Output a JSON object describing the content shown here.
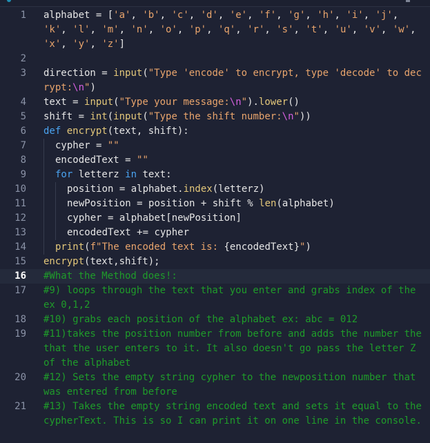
{
  "editor": {
    "language": "python",
    "current_line": 16,
    "colors": {
      "background": "#1e2233",
      "current_line_bg": "#242a3b",
      "keyword": "#4aa3f0",
      "function": "#e3c77a",
      "string": "#e8a46c",
      "escape": "#d55fde",
      "comment": "#1f9c2a",
      "line_number": "#8b93a7"
    },
    "lines": [
      {
        "n": "1",
        "tokens": [
          [
            "var",
            "alphabet "
          ],
          [
            "op",
            "= ["
          ],
          [
            "str",
            "'a'"
          ],
          [
            "op",
            ", "
          ],
          [
            "str",
            "'b'"
          ],
          [
            "op",
            ", "
          ],
          [
            "str",
            "'c'"
          ],
          [
            "op",
            ", "
          ],
          [
            "str",
            "'d'"
          ],
          [
            "op",
            ", "
          ],
          [
            "str",
            "'e'"
          ],
          [
            "op",
            ", "
          ],
          [
            "str",
            "'f'"
          ],
          [
            "op",
            ", "
          ],
          [
            "str",
            "'g'"
          ],
          [
            "op",
            ", "
          ],
          [
            "str",
            "'h'"
          ],
          [
            "op",
            ", "
          ],
          [
            "str",
            "'i'"
          ],
          [
            "op",
            ", "
          ],
          [
            "str",
            "'j'"
          ],
          [
            "op",
            ", "
          ],
          [
            "str",
            "'k'"
          ],
          [
            "op",
            ", "
          ],
          [
            "str",
            "'l'"
          ],
          [
            "op",
            ", "
          ],
          [
            "str",
            "'m'"
          ],
          [
            "op",
            ", "
          ],
          [
            "str",
            "'n'"
          ],
          [
            "op",
            ", "
          ],
          [
            "str",
            "'o'"
          ],
          [
            "op",
            ", "
          ],
          [
            "str",
            "'p'"
          ],
          [
            "op",
            ", "
          ],
          [
            "str",
            "'q'"
          ],
          [
            "op",
            ", "
          ],
          [
            "str",
            "'r'"
          ],
          [
            "op",
            ", "
          ],
          [
            "str",
            "'s'"
          ],
          [
            "op",
            ", "
          ],
          [
            "str",
            "'t'"
          ],
          [
            "op",
            ", "
          ],
          [
            "str",
            "'u'"
          ],
          [
            "op",
            ", "
          ],
          [
            "str",
            "'v'"
          ],
          [
            "op",
            ", "
          ],
          [
            "str",
            "'w'"
          ],
          [
            "op",
            ", "
          ],
          [
            "str",
            "'x'"
          ],
          [
            "op",
            ", "
          ],
          [
            "str",
            "'y'"
          ],
          [
            "op",
            ", "
          ],
          [
            "str",
            "'z'"
          ],
          [
            "op",
            "]"
          ]
        ],
        "indent": 0
      },
      {
        "n": "2",
        "tokens": [],
        "indent": 0
      },
      {
        "n": "3",
        "tokens": [
          [
            "var",
            "direction "
          ],
          [
            "op",
            "= "
          ],
          [
            "fn",
            "input"
          ],
          [
            "op",
            "("
          ],
          [
            "str",
            "\"Type 'encode' to encrypt, type 'decode' to decrypt:"
          ],
          [
            "esc",
            "\\n"
          ],
          [
            "str",
            "\""
          ],
          [
            "op",
            ")"
          ]
        ],
        "indent": 0
      },
      {
        "n": "4",
        "tokens": [
          [
            "var",
            "text "
          ],
          [
            "op",
            "= "
          ],
          [
            "fn",
            "input"
          ],
          [
            "op",
            "("
          ],
          [
            "str",
            "\"Type your message:"
          ],
          [
            "esc",
            "\\n"
          ],
          [
            "str",
            "\""
          ],
          [
            "op",
            ")."
          ],
          [
            "fn",
            "lower"
          ],
          [
            "op",
            "()"
          ]
        ],
        "indent": 0
      },
      {
        "n": "5",
        "tokens": [
          [
            "var",
            "shift "
          ],
          [
            "op",
            "= "
          ],
          [
            "fn",
            "int"
          ],
          [
            "op",
            "("
          ],
          [
            "fn",
            "input"
          ],
          [
            "op",
            "("
          ],
          [
            "str",
            "\"Type the shift number:"
          ],
          [
            "esc",
            "\\n"
          ],
          [
            "str",
            "\""
          ],
          [
            "op",
            "))"
          ]
        ],
        "indent": 0
      },
      {
        "n": "6",
        "tokens": [
          [
            "kw",
            "def "
          ],
          [
            "fn",
            "encrypt"
          ],
          [
            "op",
            "(text, shift):"
          ]
        ],
        "indent": 0
      },
      {
        "n": "7",
        "tokens": [
          [
            "var",
            "cypher "
          ],
          [
            "op",
            "= "
          ],
          [
            "str",
            "\"\""
          ]
        ],
        "indent": 1
      },
      {
        "n": "8",
        "tokens": [
          [
            "var",
            "encodedText "
          ],
          [
            "op",
            "= "
          ],
          [
            "str",
            "\"\""
          ]
        ],
        "indent": 1
      },
      {
        "n": "9",
        "tokens": [
          [
            "kw",
            "for "
          ],
          [
            "var",
            "letterz "
          ],
          [
            "kw",
            "in "
          ],
          [
            "var",
            "text:"
          ]
        ],
        "indent": 1
      },
      {
        "n": "10",
        "tokens": [
          [
            "var",
            "position "
          ],
          [
            "op",
            "= alphabet."
          ],
          [
            "fn",
            "index"
          ],
          [
            "op",
            "(letterz)"
          ]
        ],
        "indent": 2
      },
      {
        "n": "11",
        "tokens": [
          [
            "var",
            "newPosition "
          ],
          [
            "op",
            "= position + shift % "
          ],
          [
            "fn",
            "len"
          ],
          [
            "op",
            "(alphabet)"
          ]
        ],
        "indent": 2
      },
      {
        "n": "12",
        "tokens": [
          [
            "var",
            "cypher "
          ],
          [
            "op",
            "= alphabet[newPosition]"
          ]
        ],
        "indent": 2
      },
      {
        "n": "13",
        "tokens": [
          [
            "var",
            "encodedText "
          ],
          [
            "op",
            "+= cypher"
          ]
        ],
        "indent": 2
      },
      {
        "n": "14",
        "tokens": [
          [
            "fn",
            "print"
          ],
          [
            "op",
            "("
          ],
          [
            "str",
            "f\"The encoded text is: "
          ],
          [
            "var",
            "{encodedText}"
          ],
          [
            "str",
            "\""
          ],
          [
            "op",
            ")"
          ]
        ],
        "indent": 1
      },
      {
        "n": "15",
        "tokens": [
          [
            "fn",
            "encrypt"
          ],
          [
            "op",
            "(text,shift);"
          ]
        ],
        "indent": 0
      },
      {
        "n": "16",
        "tokens": [
          [
            "cm",
            "#What the Method does!:"
          ]
        ],
        "indent": 0
      },
      {
        "n": "17",
        "tokens": [
          [
            "cm",
            "#9) loops through the text that you enter and grabs index of the ex 0,1,2"
          ]
        ],
        "indent": 0
      },
      {
        "n": "18",
        "tokens": [
          [
            "cm",
            "#10) grabs each position of the alphabet ex: abc = 012"
          ]
        ],
        "indent": 0
      },
      {
        "n": "19",
        "tokens": [
          [
            "cm",
            "#11)takes the position number from before and adds the number the that the user enters to it. It also doesn't go pass the letter Z of the alphabet"
          ]
        ],
        "indent": 0
      },
      {
        "n": "20",
        "tokens": [
          [
            "cm",
            "#12) Sets the empty string cypher to the newposition number that was entered from before"
          ]
        ],
        "indent": 0
      },
      {
        "n": "21",
        "tokens": [
          [
            "cm",
            "#13) Takes the empty string encoded text and sets it equal to the cypherText. This is so I can print it on one line in the console."
          ]
        ],
        "indent": 0
      }
    ]
  }
}
